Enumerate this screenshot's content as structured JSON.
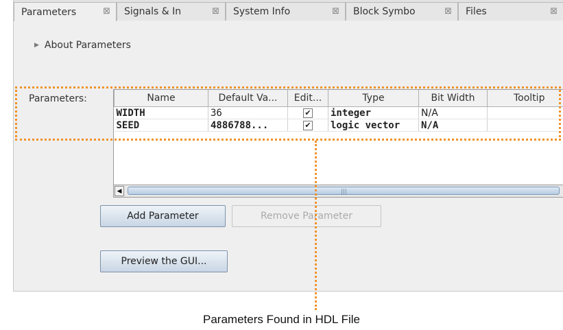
{
  "tabs": [
    {
      "label": "Parameters",
      "active": true
    },
    {
      "label": "Signals & In",
      "active": false
    },
    {
      "label": "System Info",
      "active": false
    },
    {
      "label": "Block Symbo",
      "active": false
    },
    {
      "label": "Files",
      "active": false
    }
  ],
  "close_glyph": "⊠",
  "about": {
    "label": "About Parameters",
    "icon": "triangle-right-icon"
  },
  "parameters_label": "Parameters:",
  "table": {
    "columns": [
      "Name",
      "Default Va...",
      "Edit...",
      "Type",
      "Bit Width",
      "Tooltip"
    ],
    "rows": [
      {
        "name": "WIDTH",
        "default": "36",
        "editable": true,
        "type": "integer",
        "bit_width": "N/A",
        "tooltip": ""
      },
      {
        "name": "SEED",
        "default": "4886788...",
        "editable": true,
        "type": "logic vector",
        "bit_width": "N/A",
        "tooltip": ""
      }
    ],
    "check_glyph": "✔"
  },
  "buttons": {
    "add": "Add Parameter",
    "remove": "Remove Parameter",
    "preview": "Preview the GUI..."
  },
  "scroll_left": "◀",
  "scroll_right": "▶",
  "scroll_grip": "|||",
  "callout": "Parameters Found in HDL File",
  "colors": {
    "highlight": "#f0922a",
    "button": "#c9d6e4"
  }
}
